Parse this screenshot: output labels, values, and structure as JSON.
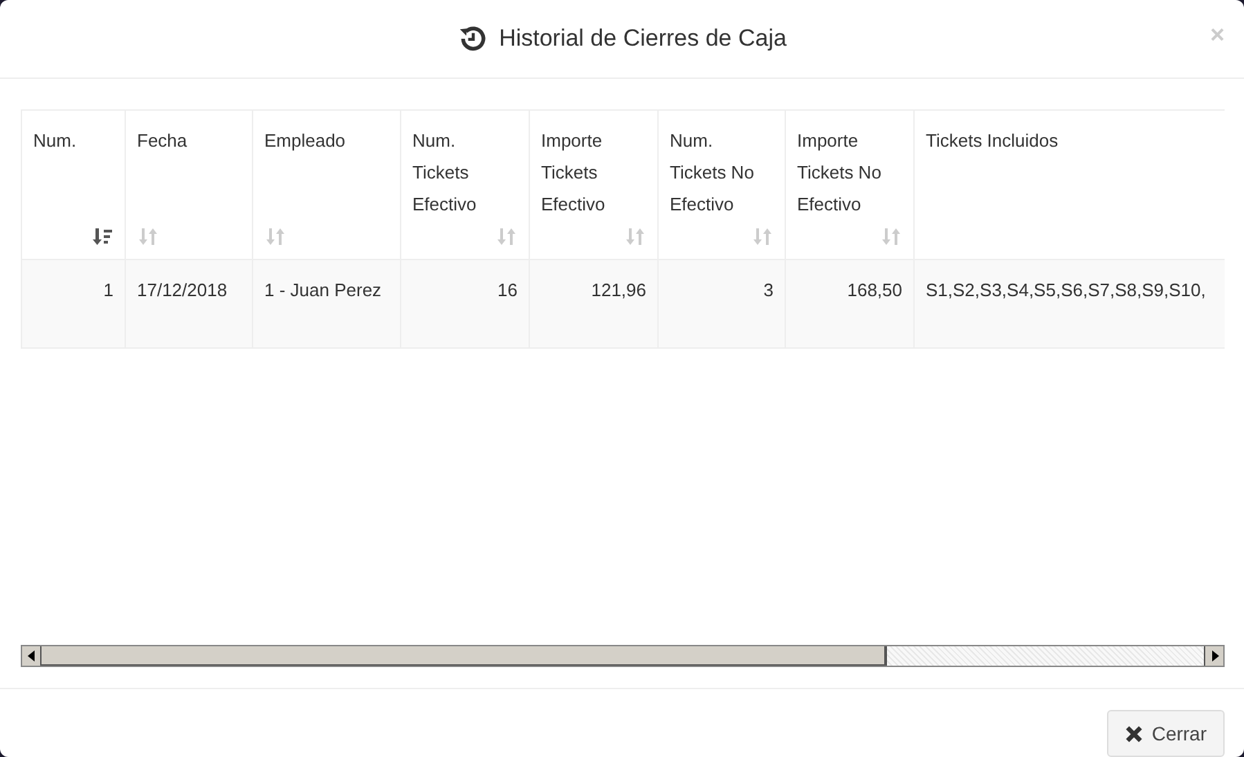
{
  "dialog": {
    "title": "Historial de Cierres de Caja",
    "close": "×"
  },
  "table": {
    "columns": [
      {
        "label": "Num.",
        "sorted": true,
        "kind": "number"
      },
      {
        "label": "Fecha",
        "sorted": false,
        "kind": "text"
      },
      {
        "label": "Empleado",
        "sorted": false,
        "kind": "text"
      },
      {
        "label": "Num. Tickets Efectivo",
        "sorted": false,
        "kind": "number"
      },
      {
        "label": "Importe Tickets Efectivo",
        "sorted": false,
        "kind": "number"
      },
      {
        "label": "Num. Tickets No Efectivo",
        "sorted": false,
        "kind": "number"
      },
      {
        "label": "Importe Tickets No Efectivo",
        "sorted": false,
        "kind": "number"
      },
      {
        "label": "Tickets Incluidos",
        "kind": "list"
      }
    ],
    "rows": [
      [
        "1",
        "17/12/2018",
        "1 - Juan Perez",
        "16",
        "121,96",
        "3",
        "168,50",
        "S1,S2,S3,S4,S5,S6,S7,S8,S9,S10,"
      ]
    ]
  },
  "footer": {
    "buttons": [
      "Cerrar"
    ]
  }
}
